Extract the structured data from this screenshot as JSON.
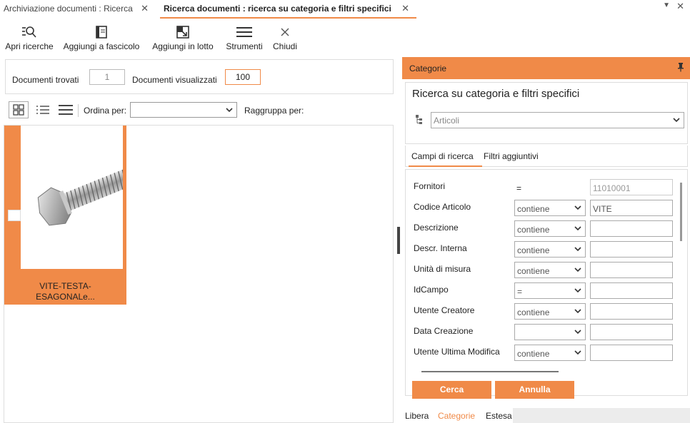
{
  "tabs": [
    {
      "label": "Archiviazione documenti : Ricerca",
      "active": false
    },
    {
      "label": "Ricerca documenti : ricerca su categoria e filtri specifici",
      "active": true
    }
  ],
  "toolbar": {
    "apri": "Apri ricerche",
    "aggiungi_fascicolo": "Aggiungi a fascicolo",
    "aggiungi_lotto": "Aggiungi in lotto",
    "strumenti": "Strumenti",
    "chiudi": "Chiudi"
  },
  "counts": {
    "trovati_label": "Documenti trovati",
    "trovati_value": "1",
    "visualizzati_label": "Documenti visualizzati",
    "visualizzati_value": "100"
  },
  "viewbar": {
    "ordina_label": "Ordina per:",
    "ordina_value": "",
    "raggruppa_label": "Raggruppa per:"
  },
  "result_card": {
    "caption_line1": "VITE-TESTA-",
    "caption_line2": "ESAGONALe..."
  },
  "right": {
    "header": "Categorie",
    "title": "Ricerca su categoria e filtri specifici",
    "category": "Articoli",
    "tab_campi": "Campi di ricerca",
    "tab_filtri": "Filtri aggiuntivi",
    "fields": [
      {
        "label": "Fornitori",
        "op": "=",
        "op_type": "text",
        "value": "11010001",
        "readonly": true
      },
      {
        "label": "Codice Articolo",
        "op": "contiene",
        "op_type": "select",
        "value": "VITE",
        "readonly": false
      },
      {
        "label": "Descrizione",
        "op": "contiene",
        "op_type": "select",
        "value": "",
        "readonly": false
      },
      {
        "label": "Descr. Interna",
        "op": "contiene",
        "op_type": "select",
        "value": "",
        "readonly": false
      },
      {
        "label": "Unità di misura",
        "op": "contiene",
        "op_type": "select",
        "value": "",
        "readonly": false
      },
      {
        "label": "IdCampo",
        "op": "=",
        "op_type": "select",
        "value": "",
        "readonly": false
      },
      {
        "label": "Utente Creatore",
        "op": "contiene",
        "op_type": "select",
        "value": "",
        "readonly": false
      },
      {
        "label": "Data Creazione",
        "op": "",
        "op_type": "select",
        "value": "",
        "readonly": false
      },
      {
        "label": "Utente Ultima Modifica",
        "op": "contiene",
        "op_type": "select",
        "value": "",
        "readonly": false
      }
    ],
    "cerca": "Cerca",
    "annulla": "Annulla",
    "bottom_tabs": [
      "Libera",
      "Categorie",
      "Estesa"
    ],
    "bottom_active": "Categorie"
  },
  "colors": {
    "accent": "#f08a48"
  }
}
